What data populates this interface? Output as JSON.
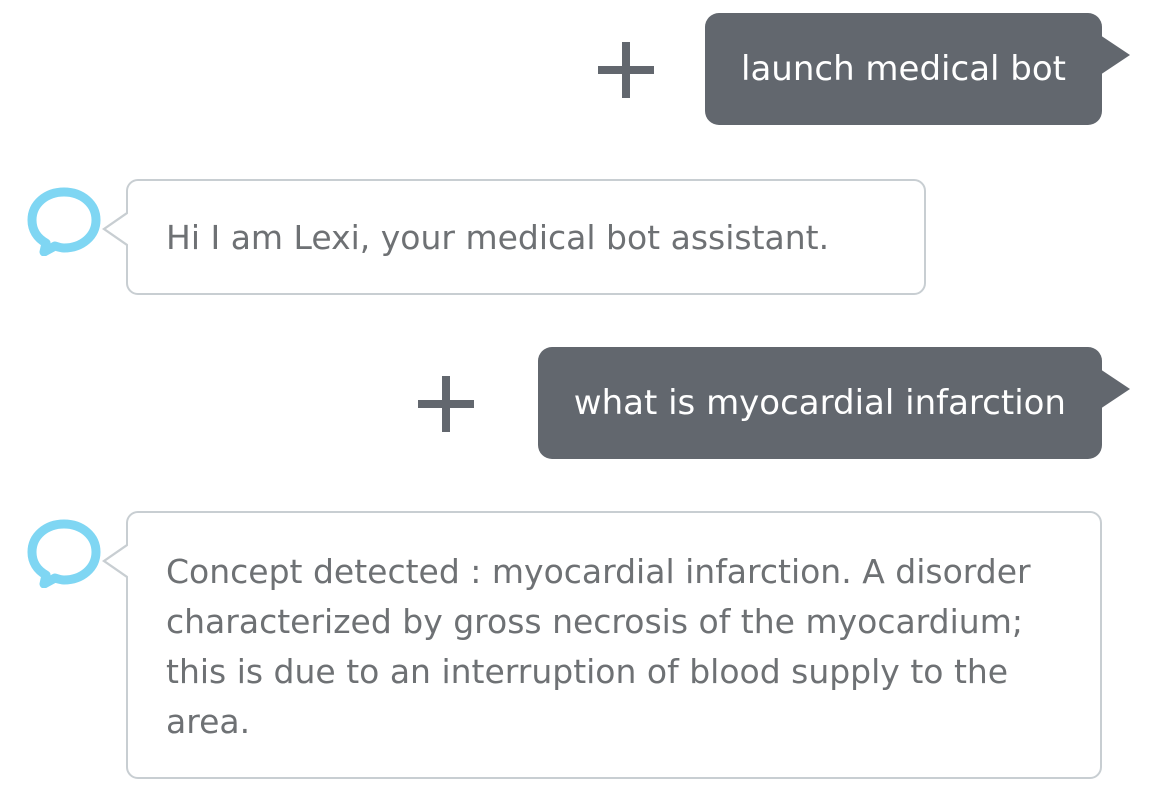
{
  "colors": {
    "user_bubble": "#62676e",
    "bot_bubble_border": "#c8ced2",
    "bot_text": "#6e7174",
    "avatar_accent": "#7fd6f3"
  },
  "conversation": {
    "user_message_1": "launch medical bot",
    "bot_message_1": "Hi I am Lexi, your medical bot assistant.",
    "user_message_2": "what is myocardial infarction",
    "bot_message_2": "Concept detected : myocardial infarction. A disorder characterized by gross necrosis of the myocardium; this is due to an interruption of blood supply to the area."
  },
  "icons": {
    "user_action": "plus-icon",
    "bot_avatar": "chat-bubble-icon"
  }
}
